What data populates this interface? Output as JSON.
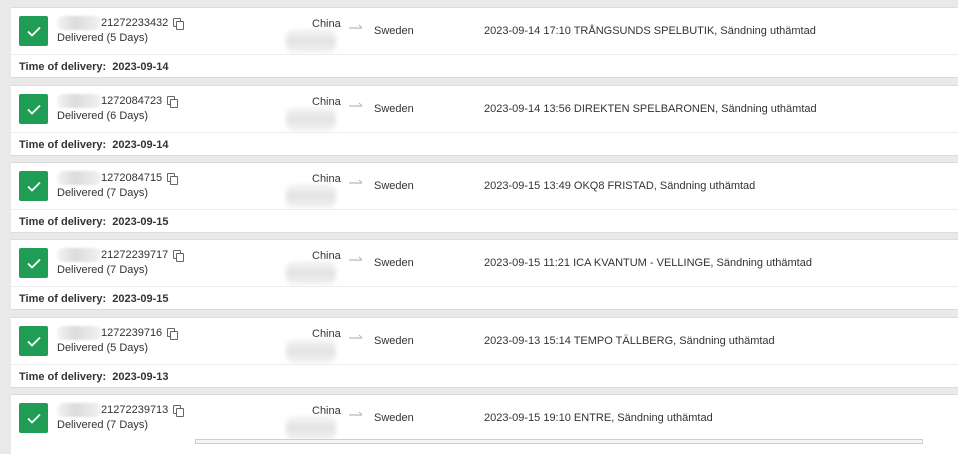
{
  "delivery_label": "Time of delivery:",
  "accent": "#1f9d55",
  "shipments": [
    {
      "tracking": "21272233432",
      "status": "Delivered (5 Days)",
      "origin": "China",
      "destination": "Sweden",
      "event": "2023-09-14 17:10 TRÅNGSUNDS SPELBUTIK, Sändning uthämtad",
      "delivery_date": "2023-09-14"
    },
    {
      "tracking": "1272084723",
      "status": "Delivered (6 Days)",
      "origin": "China",
      "destination": "Sweden",
      "event": "2023-09-14 13:56 DIREKTEN SPELBARONEN, Sändning uthämtad",
      "delivery_date": "2023-09-14"
    },
    {
      "tracking": "1272084715",
      "status": "Delivered (7 Days)",
      "origin": "China",
      "destination": "Sweden",
      "event": "2023-09-15 13:49 OKQ8 FRISTAD, Sändning uthämtad",
      "delivery_date": "2023-09-15"
    },
    {
      "tracking": "21272239717",
      "status": "Delivered (7 Days)",
      "origin": "China",
      "destination": "Sweden",
      "event": "2023-09-15 11:21 ICA KVANTUM - VELLINGE, Sändning uthämtad",
      "delivery_date": "2023-09-15"
    },
    {
      "tracking": "1272239716",
      "status": "Delivered (5 Days)",
      "origin": "China",
      "destination": "Sweden",
      "event": "2023-09-13 15:14 TEMPO TÄLLBERG, Sändning uthämtad",
      "delivery_date": "2023-09-13"
    },
    {
      "tracking": "21272239713",
      "status": "Delivered (7 Days)",
      "origin": "China",
      "destination": "Sweden",
      "event": "2023-09-15 19:10 ENTRE, Sändning uthämtad"
    }
  ]
}
